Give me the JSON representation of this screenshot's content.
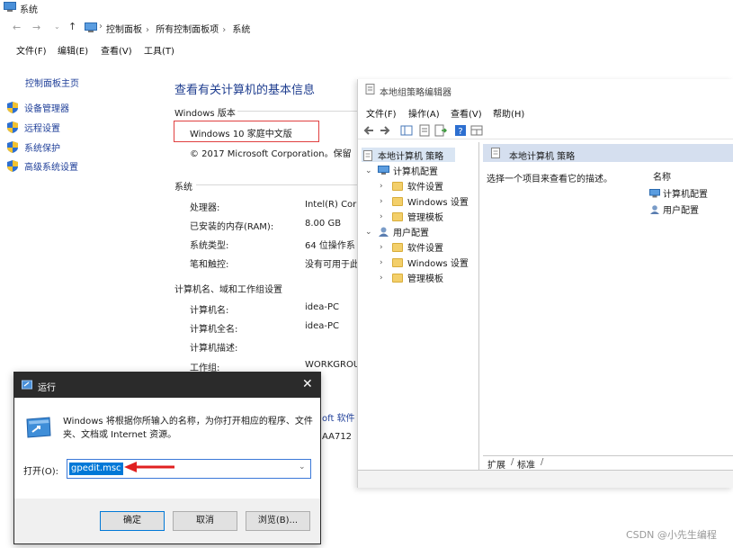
{
  "system_window": {
    "title": "系统",
    "breadcrumb": [
      "控制面板",
      "所有控制面板项",
      "系统"
    ],
    "menu": [
      "文件(F)",
      "编辑(E)",
      "查看(V)",
      "工具(T)"
    ],
    "sidebar": {
      "home": "控制面板主页",
      "links": [
        "设备管理器",
        "远程设置",
        "系统保护",
        "高级系统设置"
      ]
    },
    "main_title": "查看有关计算机的基本信息",
    "edition_section": "Windows 版本",
    "edition": "Windows 10 家庭中文版",
    "copyright": "© 2017 Microsoft Corporation。保留",
    "system_section": "系统",
    "system_rows": [
      {
        "label": "处理器:",
        "value": "Intel(R) Cor"
      },
      {
        "label": "已安装的内存(RAM):",
        "value": "8.00 GB"
      },
      {
        "label": "系统类型:",
        "value": "64 位操作系"
      },
      {
        "label": "笔和触控:",
        "value": "没有可用于此"
      }
    ],
    "computer_section": "计算机名、域和工作组设置",
    "computer_rows": [
      {
        "label": "计算机名:",
        "value": "idea-PC"
      },
      {
        "label": "计算机全名:",
        "value": "idea-PC"
      },
      {
        "label": "计算机描述:",
        "value": ""
      },
      {
        "label": "工作组:",
        "value": "WORKGROU"
      }
    ],
    "fragment_link": "oft 软件",
    "fragment_id": "AA712"
  },
  "gpe_window": {
    "title": "本地组策略编辑器",
    "menu": [
      "文件(F)",
      "操作(A)",
      "查看(V)",
      "帮助(H)"
    ],
    "tree": {
      "root": "本地计算机 策略",
      "computer_config": "计算机配置",
      "computer_children": [
        "软件设置",
        "Windows 设置",
        "管理模板"
      ],
      "user_config": "用户配置",
      "user_children": [
        "软件设置",
        "Windows 设置",
        "管理模板"
      ]
    },
    "right_header": "本地计算机 策略",
    "right_desc": "选择一个项目来查看它的描述。",
    "col_name": "名称",
    "right_items": [
      "计算机配置",
      "用户配置"
    ],
    "tabs": [
      "扩展",
      "标准"
    ]
  },
  "run_dialog": {
    "title": "运行",
    "close": "✕",
    "description": "Windows 将根据你所输入的名称，为你打开相应的程序、文件夹、文档或 Internet 资源。",
    "open_label": "打开(O):",
    "input_value": "gpedit.msc",
    "ok": "确定",
    "cancel": "取消",
    "browse": "浏览(B)..."
  },
  "watermark": "CSDN @小先生编程"
}
